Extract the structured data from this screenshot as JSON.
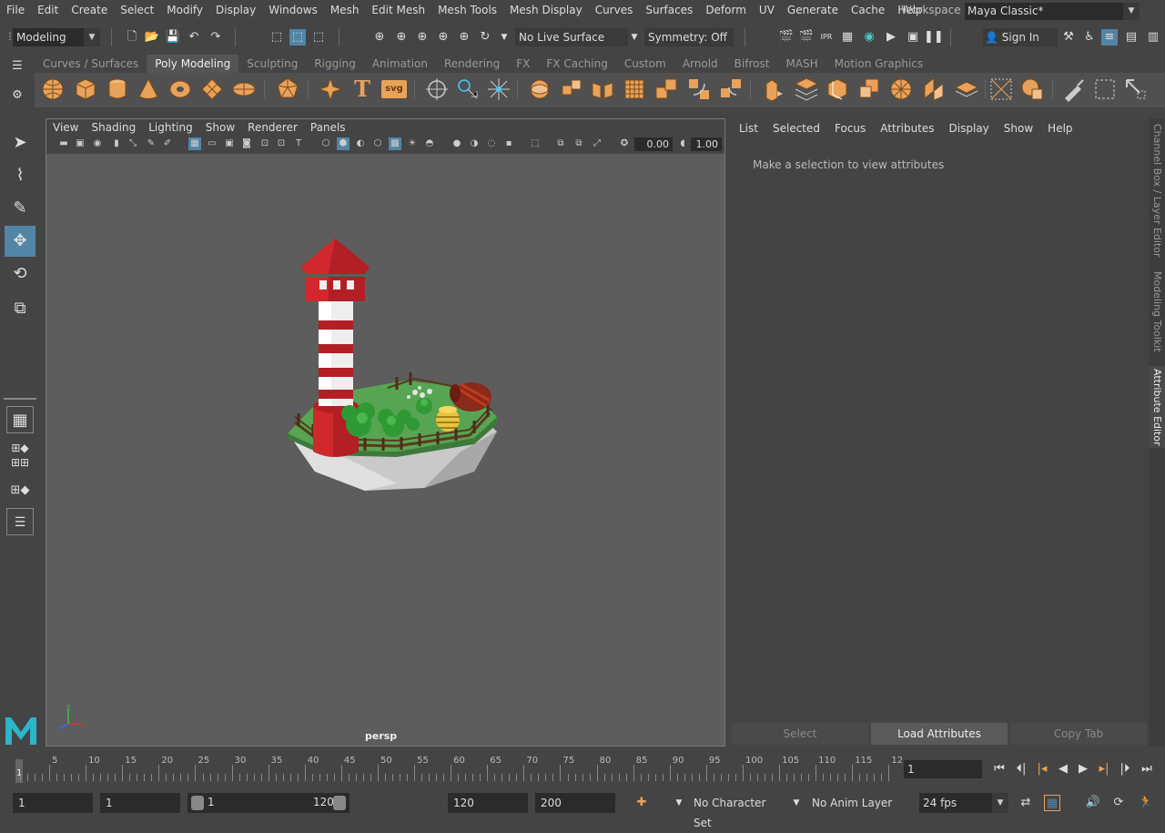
{
  "menubar": {
    "items": [
      "File",
      "Edit",
      "Create",
      "Select",
      "Modify",
      "Display",
      "Windows",
      "Mesh",
      "Edit Mesh",
      "Mesh Tools",
      "Mesh Display",
      "Curves",
      "Surfaces",
      "Deform",
      "UV",
      "Generate",
      "Cache",
      "Help"
    ],
    "workspace_label": "Workspace :",
    "workspace_value": "Maya Classic*"
  },
  "statusline": {
    "menuset": "Modeling",
    "live_surface": "No Live Surface",
    "symmetry": "Symmetry: Off",
    "sign_in": "Sign In"
  },
  "shelf": {
    "tabs": [
      "Curves / Surfaces",
      "Poly Modeling",
      "Sculpting",
      "Rigging",
      "Animation",
      "Rendering",
      "FX",
      "FX Caching",
      "Custom",
      "Arnold",
      "Bifrost",
      "MASH",
      "Motion Graphics"
    ],
    "active_tab": "Poly Modeling",
    "icon_color": "#e8a25a",
    "text_icon": "T",
    "svg_icon": "svg"
  },
  "viewport": {
    "menu": [
      "View",
      "Shading",
      "Lighting",
      "Show",
      "Renderer",
      "Panels"
    ],
    "exposure": "0.00",
    "gamma": "1.00",
    "camera": "persp",
    "axis_labels": {
      "x": "x",
      "y": "y",
      "z": "z"
    }
  },
  "attribute_editor": {
    "menu": [
      "List",
      "Selected",
      "Focus",
      "Attributes",
      "Display",
      "Show",
      "Help"
    ],
    "message": "Make a selection to view attributes",
    "buttons": [
      "Select",
      "Load Attributes",
      "Copy Tab"
    ]
  },
  "side_tabs": [
    "Channel Box / Layer Editor",
    "Modeling Toolkit",
    "Attribute Editor"
  ],
  "timeline": {
    "ticks": [
      "5",
      "10",
      "15",
      "20",
      "25",
      "30",
      "35",
      "40",
      "45",
      "50",
      "55",
      "60",
      "65",
      "70",
      "75",
      "80",
      "85",
      "90",
      "95",
      "100",
      "105",
      "110",
      "115",
      "12"
    ],
    "current_marker": "1",
    "current_frame": "1"
  },
  "range": {
    "start": "1",
    "playback_start": "1",
    "slider_start": "1",
    "slider_end": "120",
    "playback_end": "120",
    "end": "200",
    "character_set": "No Character Set",
    "anim_layer": "No Anim Layer",
    "fps": "24 fps"
  },
  "accent_color": "#5285a6"
}
